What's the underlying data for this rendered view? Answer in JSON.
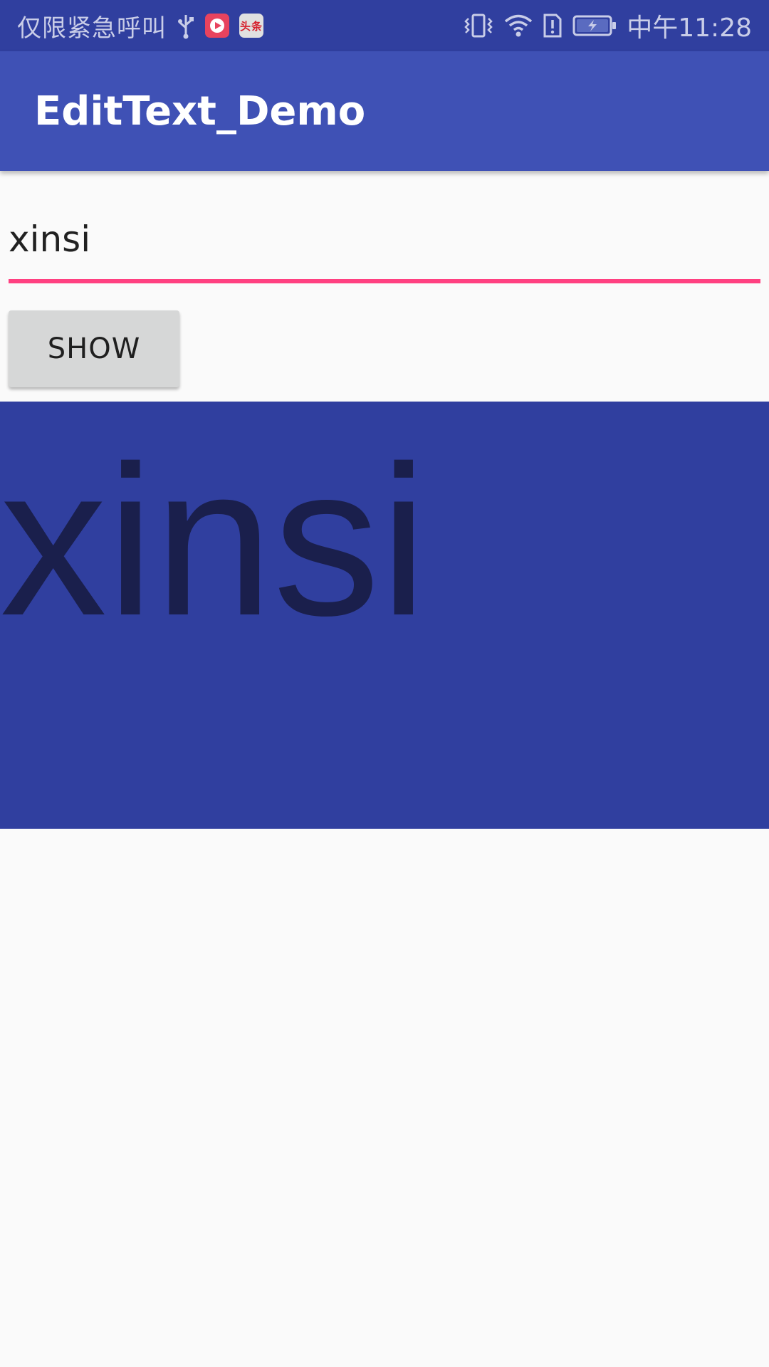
{
  "status_bar": {
    "carrier_text": "仅限紧急呼叫",
    "time": "中午11:28",
    "icons": [
      "usb-icon",
      "video-app-icon",
      "news-app-icon",
      "vibrate-icon",
      "wifi-icon",
      "sim-alert-icon",
      "battery-charging-icon"
    ],
    "news_icon_text": "头条"
  },
  "app_bar": {
    "title": "EditText_Demo"
  },
  "edit_text": {
    "value": "xinsi"
  },
  "show_button": {
    "label": "SHOW"
  },
  "display": {
    "text": "xinsi"
  },
  "colors": {
    "status_bar": "#303f9f",
    "app_bar": "#3f51b5",
    "accent": "#ff4081",
    "display_background": "#303f9f",
    "display_text": "#1a1f4c",
    "page_background": "#fafafa"
  }
}
